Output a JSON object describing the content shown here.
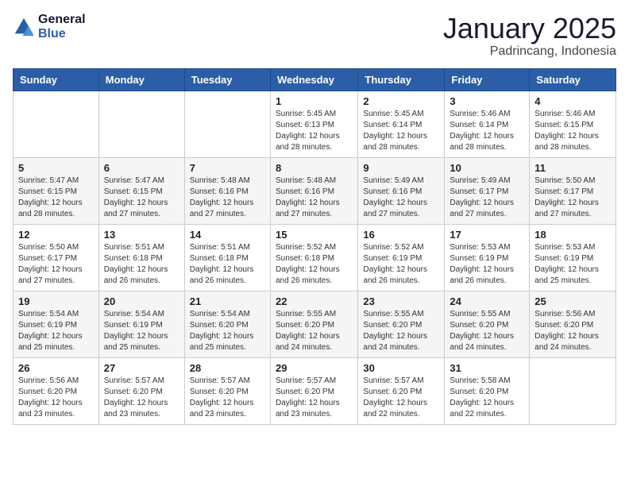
{
  "logo": {
    "line1": "General",
    "line2": "Blue"
  },
  "title": "January 2025",
  "subtitle": "Padrincang, Indonesia",
  "days_of_week": [
    "Sunday",
    "Monday",
    "Tuesday",
    "Wednesday",
    "Thursday",
    "Friday",
    "Saturday"
  ],
  "weeks": [
    [
      {
        "day": "",
        "info": ""
      },
      {
        "day": "",
        "info": ""
      },
      {
        "day": "",
        "info": ""
      },
      {
        "day": "1",
        "info": "Sunrise: 5:45 AM\nSunset: 6:13 PM\nDaylight: 12 hours\nand 28 minutes."
      },
      {
        "day": "2",
        "info": "Sunrise: 5:45 AM\nSunset: 6:14 PM\nDaylight: 12 hours\nand 28 minutes."
      },
      {
        "day": "3",
        "info": "Sunrise: 5:46 AM\nSunset: 6:14 PM\nDaylight: 12 hours\nand 28 minutes."
      },
      {
        "day": "4",
        "info": "Sunrise: 5:46 AM\nSunset: 6:15 PM\nDaylight: 12 hours\nand 28 minutes."
      }
    ],
    [
      {
        "day": "5",
        "info": "Sunrise: 5:47 AM\nSunset: 6:15 PM\nDaylight: 12 hours\nand 28 minutes."
      },
      {
        "day": "6",
        "info": "Sunrise: 5:47 AM\nSunset: 6:15 PM\nDaylight: 12 hours\nand 27 minutes."
      },
      {
        "day": "7",
        "info": "Sunrise: 5:48 AM\nSunset: 6:16 PM\nDaylight: 12 hours\nand 27 minutes."
      },
      {
        "day": "8",
        "info": "Sunrise: 5:48 AM\nSunset: 6:16 PM\nDaylight: 12 hours\nand 27 minutes."
      },
      {
        "day": "9",
        "info": "Sunrise: 5:49 AM\nSunset: 6:16 PM\nDaylight: 12 hours\nand 27 minutes."
      },
      {
        "day": "10",
        "info": "Sunrise: 5:49 AM\nSunset: 6:17 PM\nDaylight: 12 hours\nand 27 minutes."
      },
      {
        "day": "11",
        "info": "Sunrise: 5:50 AM\nSunset: 6:17 PM\nDaylight: 12 hours\nand 27 minutes."
      }
    ],
    [
      {
        "day": "12",
        "info": "Sunrise: 5:50 AM\nSunset: 6:17 PM\nDaylight: 12 hours\nand 27 minutes."
      },
      {
        "day": "13",
        "info": "Sunrise: 5:51 AM\nSunset: 6:18 PM\nDaylight: 12 hours\nand 26 minutes."
      },
      {
        "day": "14",
        "info": "Sunrise: 5:51 AM\nSunset: 6:18 PM\nDaylight: 12 hours\nand 26 minutes."
      },
      {
        "day": "15",
        "info": "Sunrise: 5:52 AM\nSunset: 6:18 PM\nDaylight: 12 hours\nand 26 minutes."
      },
      {
        "day": "16",
        "info": "Sunrise: 5:52 AM\nSunset: 6:19 PM\nDaylight: 12 hours\nand 26 minutes."
      },
      {
        "day": "17",
        "info": "Sunrise: 5:53 AM\nSunset: 6:19 PM\nDaylight: 12 hours\nand 26 minutes."
      },
      {
        "day": "18",
        "info": "Sunrise: 5:53 AM\nSunset: 6:19 PM\nDaylight: 12 hours\nand 25 minutes."
      }
    ],
    [
      {
        "day": "19",
        "info": "Sunrise: 5:54 AM\nSunset: 6:19 PM\nDaylight: 12 hours\nand 25 minutes."
      },
      {
        "day": "20",
        "info": "Sunrise: 5:54 AM\nSunset: 6:19 PM\nDaylight: 12 hours\nand 25 minutes."
      },
      {
        "day": "21",
        "info": "Sunrise: 5:54 AM\nSunset: 6:20 PM\nDaylight: 12 hours\nand 25 minutes."
      },
      {
        "day": "22",
        "info": "Sunrise: 5:55 AM\nSunset: 6:20 PM\nDaylight: 12 hours\nand 24 minutes."
      },
      {
        "day": "23",
        "info": "Sunrise: 5:55 AM\nSunset: 6:20 PM\nDaylight: 12 hours\nand 24 minutes."
      },
      {
        "day": "24",
        "info": "Sunrise: 5:55 AM\nSunset: 6:20 PM\nDaylight: 12 hours\nand 24 minutes."
      },
      {
        "day": "25",
        "info": "Sunrise: 5:56 AM\nSunset: 6:20 PM\nDaylight: 12 hours\nand 24 minutes."
      }
    ],
    [
      {
        "day": "26",
        "info": "Sunrise: 5:56 AM\nSunset: 6:20 PM\nDaylight: 12 hours\nand 23 minutes."
      },
      {
        "day": "27",
        "info": "Sunrise: 5:57 AM\nSunset: 6:20 PM\nDaylight: 12 hours\nand 23 minutes."
      },
      {
        "day": "28",
        "info": "Sunrise: 5:57 AM\nSunset: 6:20 PM\nDaylight: 12 hours\nand 23 minutes."
      },
      {
        "day": "29",
        "info": "Sunrise: 5:57 AM\nSunset: 6:20 PM\nDaylight: 12 hours\nand 23 minutes."
      },
      {
        "day": "30",
        "info": "Sunrise: 5:57 AM\nSunset: 6:20 PM\nDaylight: 12 hours\nand 22 minutes."
      },
      {
        "day": "31",
        "info": "Sunrise: 5:58 AM\nSunset: 6:20 PM\nDaylight: 12 hours\nand 22 minutes."
      },
      {
        "day": "",
        "info": ""
      }
    ]
  ]
}
